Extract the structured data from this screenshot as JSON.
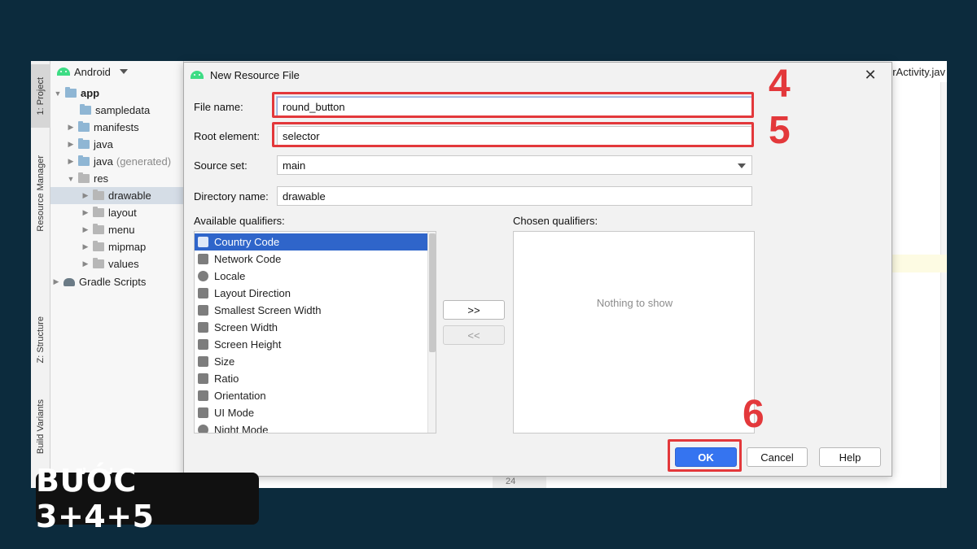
{
  "sidebar_tabs": {
    "project": "1: Project",
    "resource_manager": "Resource Manager",
    "structure": "Z: Structure",
    "build_variants": "Build Variants"
  },
  "project_panel": {
    "view_mode": "Android",
    "tree": {
      "app": "app",
      "sampledata": "sampledata",
      "manifests": "manifests",
      "java": "java",
      "java_generated": "java",
      "generated_suffix": "(generated)",
      "res": "res",
      "drawable": "drawable",
      "layout": "layout",
      "menu": "menu",
      "mipmap": "mipmap",
      "values": "values",
      "gradle_scripts": "Gradle Scripts"
    }
  },
  "editor": {
    "tab_label": "orActivity.jav",
    "line_number": "24"
  },
  "dialog": {
    "title": "New Resource File",
    "close_glyph": "✕",
    "file_name_label": "File name:",
    "file_name_value": "round_button",
    "root_element_label": "Root element:",
    "root_element_value": "selector",
    "source_set_label": "Source set:",
    "source_set_value": "main",
    "directory_name_label": "Directory name:",
    "directory_name_value": "drawable",
    "available_qualifiers_label": "Available qualifiers:",
    "chosen_qualifiers_label": "Chosen qualifiers:",
    "available_qualifiers": [
      "Country Code",
      "Network Code",
      "Locale",
      "Layout Direction",
      "Smallest Screen Width",
      "Screen Width",
      "Screen Height",
      "Size",
      "Ratio",
      "Orientation",
      "UI Mode",
      "Night Mode"
    ],
    "selected_qualifier": "Country Code",
    "add_button": ">>",
    "remove_button": "<<",
    "empty_text": "Nothing to show",
    "ok_button": "OK",
    "cancel_button": "Cancel",
    "help_button": "Help"
  },
  "annotations": {
    "step_4": "4",
    "step_5": "5",
    "step_6": "6",
    "color": "#e3383b"
  },
  "banner": {
    "text": "BƯỚC 3+4+5"
  },
  "colors": {
    "background": "#0c2b3d",
    "selection": "#2f65ca",
    "primary_button": "#3574f0",
    "android_green": "#3ddc84"
  }
}
